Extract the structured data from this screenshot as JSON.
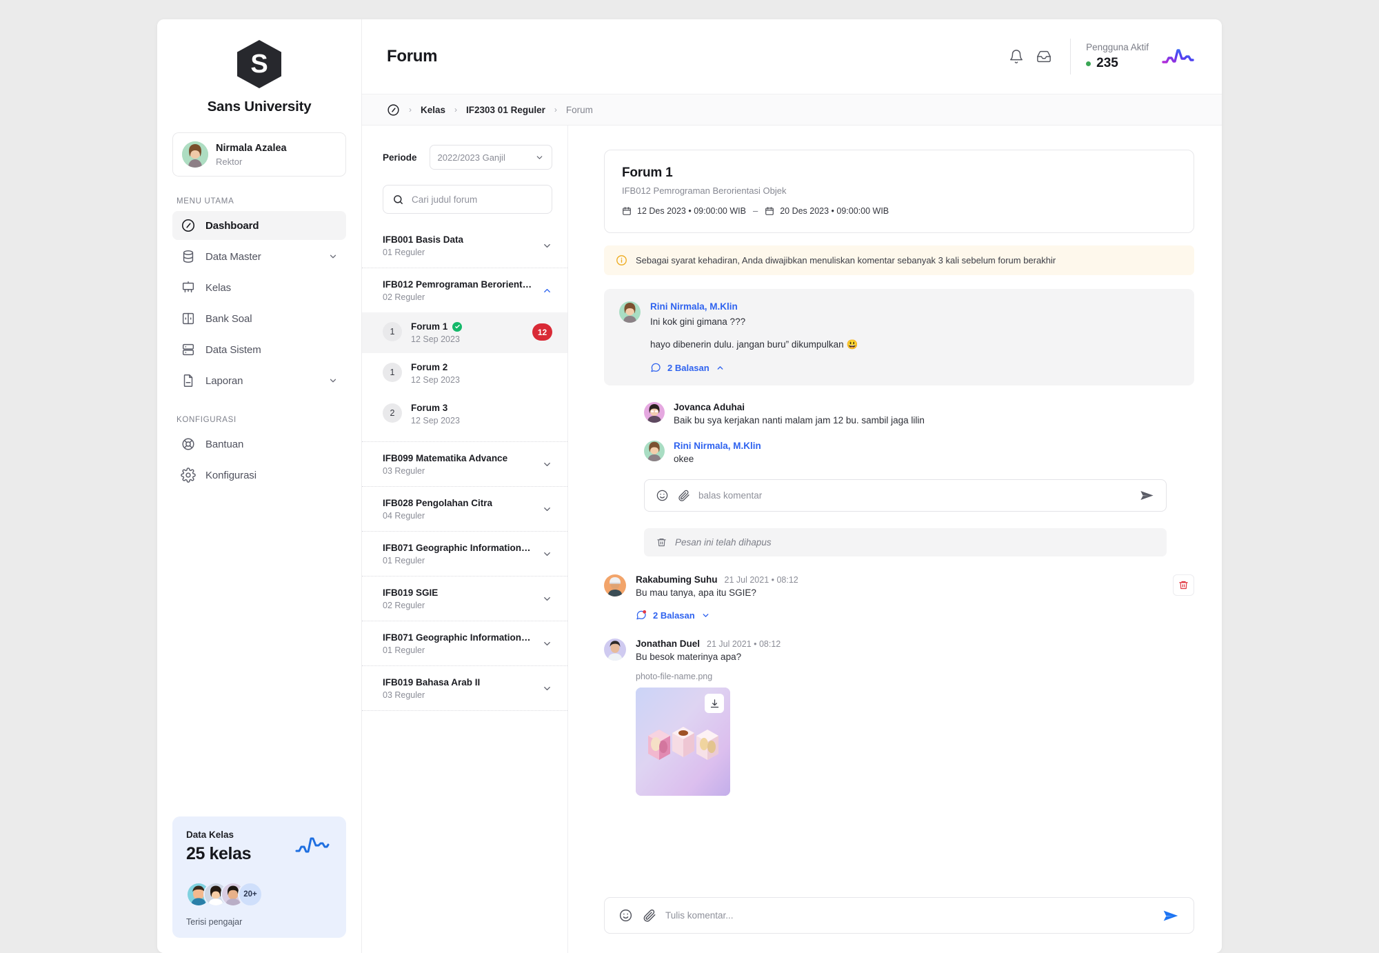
{
  "brand": {
    "logo_letter": "S",
    "name": "Sans University"
  },
  "user": {
    "name": "Nirmala Azalea",
    "role": "Rektor"
  },
  "sidebar": {
    "section_main": "MENU UTAMA",
    "section_config": "KONFIGURASI",
    "items": [
      {
        "label": "Dashboard",
        "icon": "dashboard-icon",
        "active": true,
        "chevron": false
      },
      {
        "label": "Data Master",
        "icon": "database-icon",
        "active": false,
        "chevron": true
      },
      {
        "label": "Kelas",
        "icon": "board-icon",
        "active": false,
        "chevron": false
      },
      {
        "label": "Bank Soal",
        "icon": "bank-soal-icon",
        "active": false,
        "chevron": false
      },
      {
        "label": "Data Sistem",
        "icon": "server-icon",
        "active": false,
        "chevron": false
      },
      {
        "label": "Laporan",
        "icon": "report-icon",
        "active": false,
        "chevron": true
      }
    ],
    "config_items": [
      {
        "label": "Bantuan",
        "icon": "lifebuoy-icon"
      },
      {
        "label": "Konfigurasi",
        "icon": "gear-icon"
      }
    ],
    "stat_card": {
      "title": "Data Kelas",
      "value": "25 kelas",
      "more_count": "20+",
      "footer": "Terisi pengajar",
      "accent": "#1f6fe0",
      "background": "#eaf0fd"
    }
  },
  "header": {
    "title": "Forum",
    "bell_icon": "bell-icon",
    "inbox_icon": "inbox-icon",
    "active_users_label": "Pengguna Aktif",
    "active_users_count": "235",
    "status_color": "#3aa655"
  },
  "breadcrumb": {
    "home_icon": "dashboard-icon",
    "items": [
      "Kelas",
      "IF2303 01 Reguler",
      "Forum"
    ],
    "separator": "›"
  },
  "list_panel": {
    "periode_label": "Periode",
    "periode_value": "2022/2023 Ganjil",
    "search_placeholder": "Cari judul forum",
    "search_value": "",
    "courses": [
      {
        "code_title": "IFB001 Basis Data",
        "sub": "01 Reguler",
        "open": false
      },
      {
        "code_title": "IFB012 Pemrograman Berorientasi...",
        "sub": "02 Reguler",
        "open": true,
        "forums": [
          {
            "num": "1",
            "title": "Forum 1",
            "date": "12 Sep 2023",
            "verified": true,
            "count": "12",
            "selected": true
          },
          {
            "num": "1",
            "title": "Forum 2",
            "date": "12 Sep 2023",
            "verified": false,
            "count": "",
            "selected": false
          },
          {
            "num": "2",
            "title": "Forum 3",
            "date": "12 Sep 2023",
            "verified": false,
            "count": "",
            "selected": false
          }
        ]
      },
      {
        "code_title": "IFB099 Matematika Advance",
        "sub": "03 Reguler",
        "open": false
      },
      {
        "code_title": "IFB028 Pengolahan Citra",
        "sub": "04 Reguler",
        "open": false
      },
      {
        "code_title": "IFB071 Geographic Information Sys...",
        "sub": "01 Reguler",
        "open": false
      },
      {
        "code_title": "IFB019 SGIE",
        "sub": "02 Reguler",
        "open": false
      },
      {
        "code_title": "IFB071 Geographic Information Sys...",
        "sub": "01 Reguler",
        "open": false
      },
      {
        "code_title": "IFB019 Bahasa Arab II",
        "sub": "03 Reguler",
        "open": false
      }
    ]
  },
  "forum": {
    "title": "Forum 1",
    "course": "IFB012 Pemrograman Berorientasi Objek",
    "start_date": "12 Des 2023 • 09:00:00 WIB",
    "end_date": "20 Des 2023 • 09:00:00 WIB",
    "date_separator": "–",
    "notice": "Sebagai syarat kehadiran, Anda diwajibkan menuliskan komentar sebanyak 3 kali sebelum forum berakhir"
  },
  "thread": {
    "main_post": {
      "author": "Rini Nirmala, M.Klin",
      "line1": "Ini kok gini gimana ???",
      "line2": "hayo dibenerin dulu. jangan buru” dikumpulkan 😃",
      "replies_label": "2 Balasan",
      "expanded": true
    },
    "replies": [
      {
        "author": "Jovanca Aduhai",
        "blue": false,
        "text": "Baik bu sya kerjakan nanti malam jam 12 bu. sambil jaga lilin"
      },
      {
        "author": "Rini Nirmala, M.Klin",
        "blue": true,
        "text": "okee"
      }
    ],
    "reply_input_placeholder": "balas komentar",
    "deleted_message": "Pesan ini telah dihapus",
    "comments": [
      {
        "author": "Rakabuming Suhu",
        "meta": "21 Jul 2021 • 08:12",
        "text": "Bu mau tanya, apa itu SGIE?",
        "replies_label": "2 Balasan",
        "has_delete": true,
        "has_attachment": false
      },
      {
        "author": "Jonathan Duel",
        "meta": "21 Jul 2021 • 08:12",
        "text": "Bu besok materinya apa?",
        "replies_label": "",
        "has_delete": false,
        "has_attachment": true,
        "file_name": "photo-file-name.png"
      }
    ]
  },
  "composer": {
    "placeholder": "Tulis komentar...",
    "emoji_icon": "smiley-icon",
    "attach_icon": "paperclip-icon",
    "send_icon": "send-icon",
    "send_color": "#1d74f2"
  }
}
